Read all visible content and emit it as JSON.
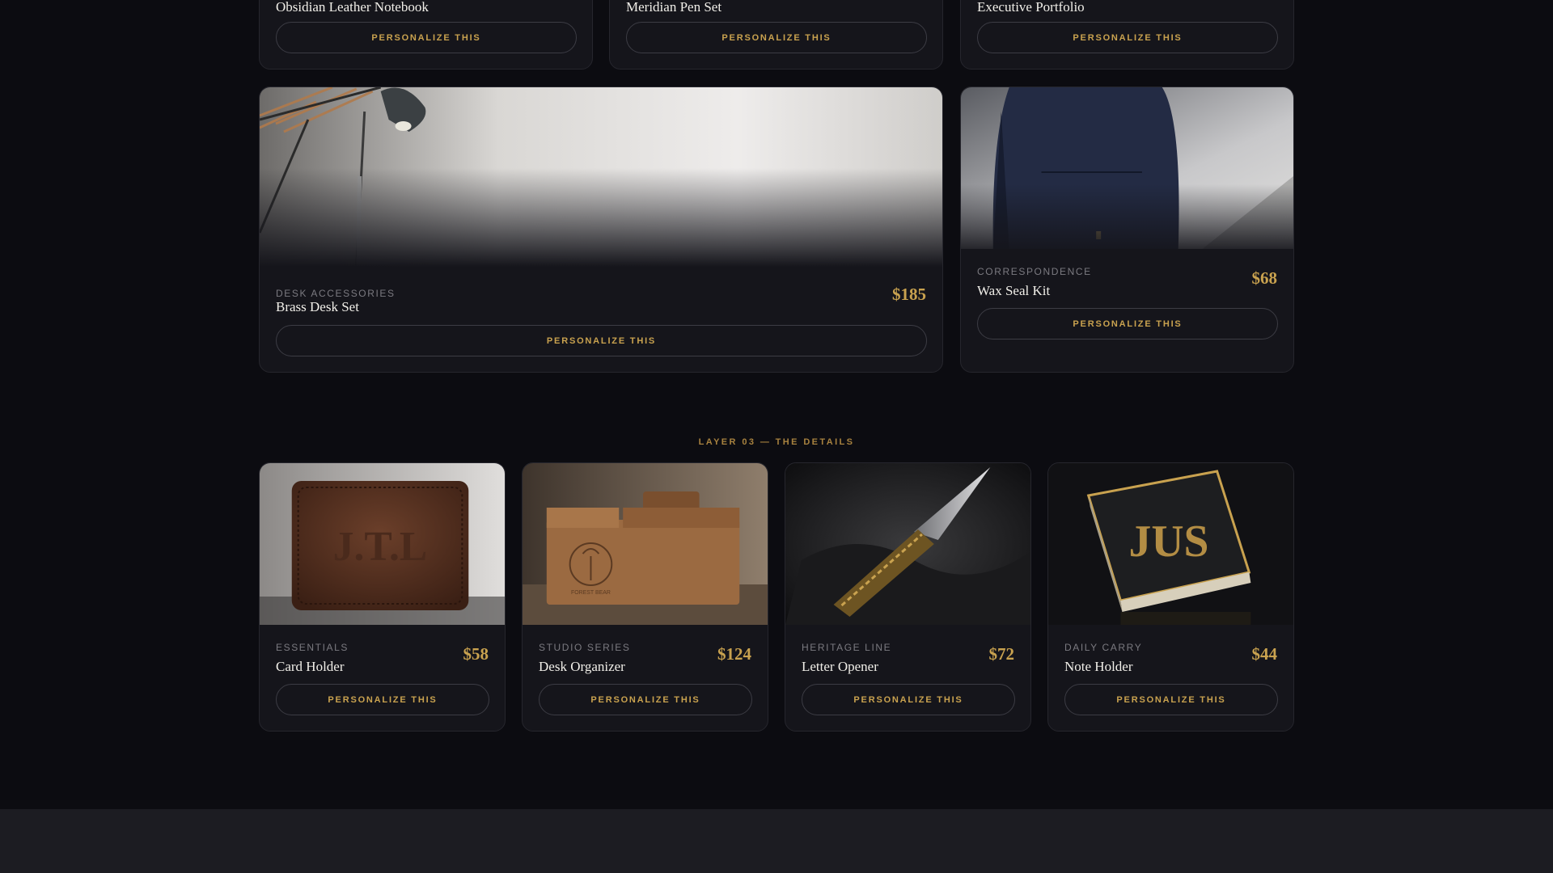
{
  "top_row": [
    {
      "title": "Obsidian Leather Notebook",
      "button": "PERSONALIZE THIS"
    },
    {
      "title": "Meridian Pen Set",
      "button": "PERSONALIZE THIS"
    },
    {
      "title": "Executive Portfolio",
      "button": "PERSONALIZE THIS"
    }
  ],
  "featured": [
    {
      "category": "DESK ACCESSORIES",
      "title": "Brass Desk Set",
      "price": "$185",
      "button": "PERSONALIZE THIS",
      "image_icon": "desk-lamp-photo"
    },
    {
      "category": "CORRESPONDENCE",
      "title": "Wax Seal Kit",
      "price": "$68",
      "button": "PERSONALIZE THIS",
      "image_icon": "backpack-photo"
    }
  ],
  "section": {
    "label": "LAYER 03 — THE DETAILS"
  },
  "details": [
    {
      "category": "ESSENTIALS",
      "title": "Card Holder",
      "price": "$58",
      "button": "PERSONALIZE THIS",
      "image_icon": "leather-card-holder-photo",
      "monogram": "J.T.L"
    },
    {
      "category": "STUDIO SERIES",
      "title": "Desk Organizer",
      "price": "$124",
      "button": "PERSONALIZE THIS",
      "image_icon": "wooden-organizer-photo",
      "engraving": "FOREST BEAR"
    },
    {
      "category": "HERITAGE LINE",
      "title": "Letter Opener",
      "price": "$72",
      "button": "PERSONALIZE THIS",
      "image_icon": "letter-opener-photo"
    },
    {
      "category": "DAILY CARRY",
      "title": "Note Holder",
      "price": "$44",
      "button": "PERSONALIZE THIS",
      "image_icon": "monogram-box-photo",
      "monogram": "JUS"
    }
  ],
  "colors": {
    "background": "#0c0c11",
    "card": "#15151b",
    "accent_gold": "#c9a24f",
    "footer": "#1c1c22"
  }
}
